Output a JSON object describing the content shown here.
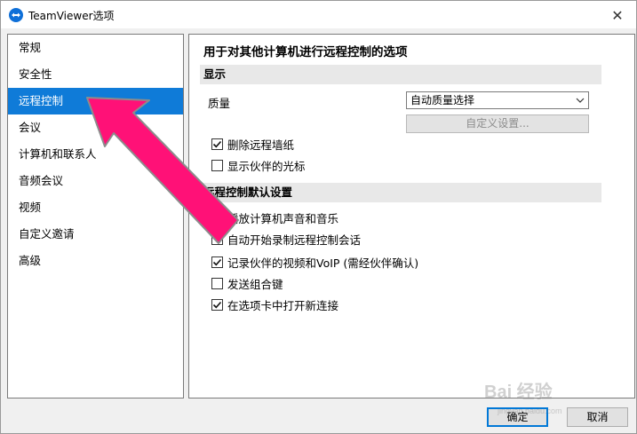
{
  "window": {
    "title": "TeamViewer选项",
    "close_glyph": "✕"
  },
  "sidebar": {
    "items": [
      {
        "label": "常规",
        "active": false
      },
      {
        "label": "安全性",
        "active": false
      },
      {
        "label": "远程控制",
        "active": true
      },
      {
        "label": "会议",
        "active": false
      },
      {
        "label": "计算机和联系人",
        "active": false
      },
      {
        "label": "音频会议",
        "active": false
      },
      {
        "label": "视频",
        "active": false
      },
      {
        "label": "自定义邀请",
        "active": false
      },
      {
        "label": "高级",
        "active": false
      }
    ]
  },
  "main": {
    "header": "用于对其他计算机进行远程控制的选项",
    "display_section": {
      "title": "显示",
      "quality_label": "质量",
      "quality_value": "自动质量选择",
      "custom_settings_button": "自定义设置...",
      "options": [
        {
          "label": "删除远程墙纸",
          "checked": true
        },
        {
          "label": "显示伙伴的光标",
          "checked": false
        }
      ]
    },
    "defaults_section": {
      "title": "远程控制默认设置",
      "options": [
        {
          "label": "播放计算机声音和音乐",
          "checked": true
        },
        {
          "label": "自动开始录制远程控制会话",
          "checked": false
        },
        {
          "label": "记录伙伴的视频和VoIP (需经伙伴确认)",
          "checked": true
        },
        {
          "label": "发送组合键",
          "checked": false
        },
        {
          "label": "在选项卡中打开新连接",
          "checked": true
        }
      ]
    }
  },
  "footer": {
    "ok_label": "确定",
    "cancel_label": "取消"
  },
  "watermark": {
    "text": "Bai 经验",
    "sub": "jingyan.baidu.com"
  },
  "colors": {
    "accent": "#0f7bd8",
    "arrow": "#ff1177"
  }
}
